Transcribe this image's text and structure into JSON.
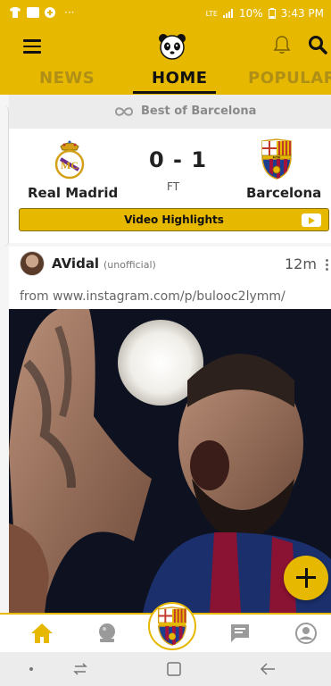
{
  "status_bar": {
    "left_icons": [
      "shirt-icon",
      "message-icon",
      "plus-circle-icon"
    ],
    "more": "···",
    "network": "LTE",
    "battery": "10%",
    "time": "3:43 PM"
  },
  "header": {
    "menu_icon": "hamburger-icon",
    "logo_icon": "panda-logo-icon",
    "notifications_icon": "bell-icon",
    "search_icon": "search-icon",
    "tabs": [
      {
        "label": "NEWS",
        "active": false
      },
      {
        "label": "HOME",
        "active": true
      },
      {
        "label": "POPULAR",
        "active": false
      }
    ]
  },
  "section": {
    "icon": "infinity-icon",
    "label": "Best of Barcelona"
  },
  "match": {
    "home_team": "Real Madrid",
    "away_team": "Barcelona",
    "score": "0 - 1",
    "status": "FT",
    "highlights_label": "Video Highlights"
  },
  "post": {
    "author": "AVidal",
    "author_tag": "(unofficial)",
    "time": "12m",
    "source": "from www.instagram.com/p/bulooc2lymm/"
  },
  "colors": {
    "accent": "#e6b800",
    "barca_blue": "#1a3f8f",
    "barca_red": "#a3123a"
  },
  "bottom_nav": {
    "items": [
      "home-icon",
      "crystal-ball-icon",
      "club-badge-icon",
      "chat-icon",
      "profile-icon"
    ]
  },
  "system_nav": {
    "items": [
      "dot-icon",
      "recent-apps-icon",
      "home-square-icon",
      "back-icon"
    ]
  }
}
